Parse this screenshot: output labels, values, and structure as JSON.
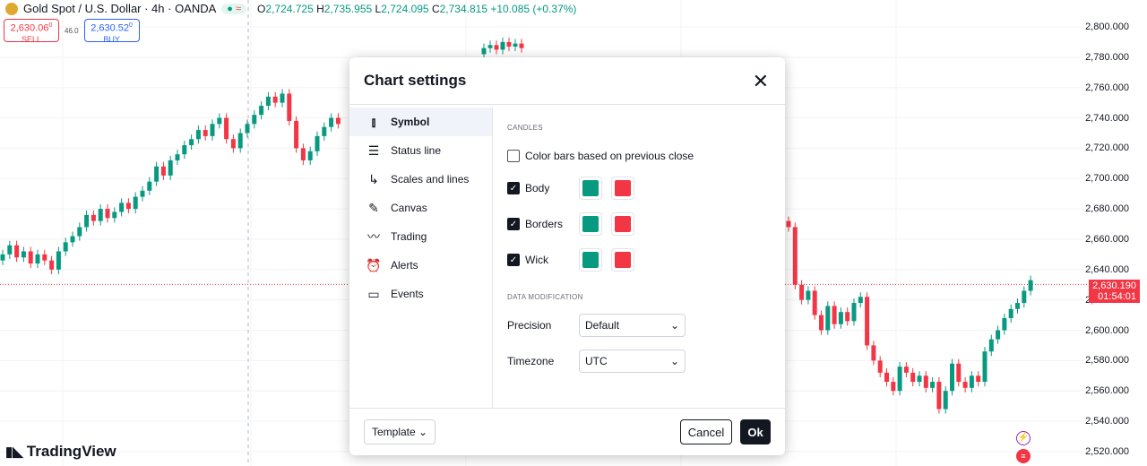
{
  "header": {
    "symbol": "Gold Spot / U.S. Dollar · 4h · OANDA",
    "status_icon": "≈",
    "ohlc": {
      "o_label": "O",
      "o": "2,724.725",
      "h_label": "H",
      "h": "2,735.955",
      "l_label": "L",
      "l": "2,724.095",
      "c_label": "C",
      "c": "2,734.815",
      "change": "+10.085 (+0.37%)"
    }
  },
  "trade": {
    "sell_price": "2,630.06",
    "sell_sup": "0",
    "sell_label": "SELL",
    "spread": "46.0",
    "buy_price": "2,630.52",
    "buy_sup": "0",
    "buy_label": "BUY"
  },
  "price_axis": [
    "2,800.000",
    "2,780.000",
    "2,760.000",
    "2,740.000",
    "2,720.000",
    "2,700.000",
    "2,680.000",
    "2,660.000",
    "2,640.000",
    "2,620.000",
    "2,600.000",
    "2,580.000",
    "2,560.000",
    "2,540.000",
    "2,520.000"
  ],
  "last_price": {
    "value": "2,630.190",
    "countdown": "01:54:01"
  },
  "colors": {
    "up": "#089981",
    "down": "#f23645"
  },
  "logo": "TradingView",
  "chart_data": {
    "type": "candlestick",
    "current_price": 2630.19,
    "left_closes": [
      2650,
      2656,
      2648,
      2652,
      2644,
      2650,
      2646,
      2640,
      2652,
      2658,
      2662,
      2668,
      2676,
      2672,
      2680,
      2674,
      2678,
      2684,
      2680,
      2688,
      2692,
      2698,
      2708,
      2702,
      2712,
      2716,
      2722,
      2726,
      2732,
      2728,
      2736,
      2740,
      2726,
      2720,
      2730,
      2736,
      2742,
      2748,
      2754,
      2750,
      2756,
      2738,
      2720,
      2712,
      2718,
      2728,
      2734,
      2740,
      2736
    ],
    "top_closes": [
      2786,
      2788,
      2785,
      2790,
      2787,
      2789,
      2786
    ],
    "right_closes": [
      2668,
      2630,
      2620,
      2626,
      2610,
      2600,
      2616,
      2604,
      2612,
      2606,
      2618,
      2622,
      2590,
      2580,
      2572,
      2566,
      2560,
      2576,
      2572,
      2566,
      2570,
      2562,
      2566,
      2548,
      2560,
      2578,
      2566,
      2562,
      2570,
      2566,
      2586,
      2594,
      2600,
      2608,
      2614,
      2618,
      2626,
      2633
    ]
  },
  "dialog": {
    "title": "Chart settings",
    "nav": [
      {
        "label": "Symbol",
        "icon": "candles-icon"
      },
      {
        "label": "Status line",
        "icon": "status-line-icon"
      },
      {
        "label": "Scales and lines",
        "icon": "scales-icon"
      },
      {
        "label": "Canvas",
        "icon": "pencil-icon"
      },
      {
        "label": "Trading",
        "icon": "trading-icon"
      },
      {
        "label": "Alerts",
        "icon": "alarm-clock-icon"
      },
      {
        "label": "Events",
        "icon": "calendar-icon"
      }
    ],
    "candles_header": "CANDLES",
    "color_bars_label": "Color bars based on previous close",
    "color_bars_checked": false,
    "rows": [
      {
        "label": "Body",
        "checked": true
      },
      {
        "label": "Borders",
        "checked": true
      },
      {
        "label": "Wick",
        "checked": true
      }
    ],
    "data_mod_header": "DATA MODIFICATION",
    "precision_label": "Precision",
    "precision_value": "Default",
    "timezone_label": "Timezone",
    "timezone_value": "UTC",
    "template_label": "Template",
    "cancel_label": "Cancel",
    "ok_label": "Ok"
  }
}
